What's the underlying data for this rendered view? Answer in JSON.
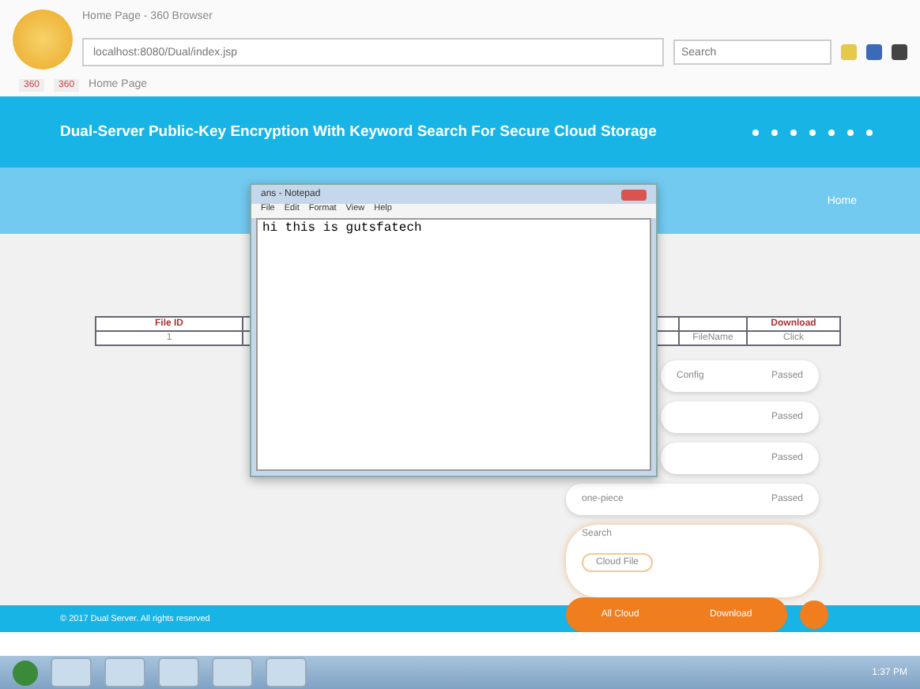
{
  "browser": {
    "tab_title": "Home Page - 360 Browser",
    "address": "localhost:8080/Dual/index.jsp",
    "search_placeholder": "Search",
    "bookmarks": [
      "360",
      "360"
    ],
    "page_tab": "Home Page"
  },
  "header": {
    "title": "Dual-Server Public-Key Encryption With Keyword Search For Secure Cloud Storage"
  },
  "nav": {
    "link": "Home"
  },
  "table": {
    "columns": [
      "File ID",
      "Download"
    ],
    "rows": [
      [
        "1",
        "Click"
      ]
    ],
    "partial_cell": "FileName"
  },
  "notepad": {
    "title": "ans - Notepad",
    "menu": [
      "File",
      "Edit",
      "Format",
      "View",
      "Help"
    ],
    "content": "hi this is gutsfatech"
  },
  "float_menu": {
    "items": [
      {
        "label": "Config",
        "status": "Passed"
      },
      {
        "status": "Passed"
      },
      {
        "status": "Passed"
      },
      {
        "label": "one-piece",
        "status": "Passed"
      }
    ],
    "search_label": "Search",
    "search_button": "Cloud File"
  },
  "footer": {
    "text": "© 2017 Dual Server. All rights reserved",
    "pill": [
      "All Cloud",
      "Download"
    ]
  },
  "taskbar": {
    "clock": "1:37 PM"
  }
}
